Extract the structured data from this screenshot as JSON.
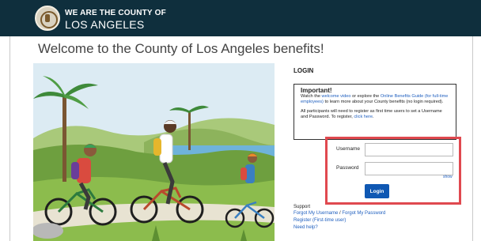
{
  "header": {
    "brand_line1": "WE ARE THE COUNTY OF",
    "brand_line2": "LOS ANGELES"
  },
  "page": {
    "welcome_title": "Welcome to the County of Los Angeles benefits!"
  },
  "login": {
    "section_title": "LOGIN",
    "notice": {
      "heading": "Important!",
      "text_watch": "Watch the ",
      "link_video": "welcome video",
      "text_or": " or explore the ",
      "link_guide": "Online Benefits Guide (for full-time employees)",
      "text_after_guide": " to learn more about your County benefits (no login required).",
      "text_register": "All participants will need to register as first time users to set a Username and Password. To register, ",
      "link_click_here": "click here",
      "text_end": "."
    },
    "username_label": "Username",
    "username_value": "",
    "password_label": "Password",
    "password_value": "",
    "show_label": "show",
    "login_button": "Login"
  },
  "support": {
    "title": "Support",
    "forgot_username": "Forgot My Username",
    "separator": " / ",
    "forgot_password": "Forgot My Password",
    "register": "Register (First-time user)",
    "need_help": "Need help?"
  },
  "colors": {
    "header_bg": "#0f2f3d",
    "link": "#1f5fbf",
    "login_button": "#0f58b3",
    "highlight_border": "#e0494f"
  }
}
